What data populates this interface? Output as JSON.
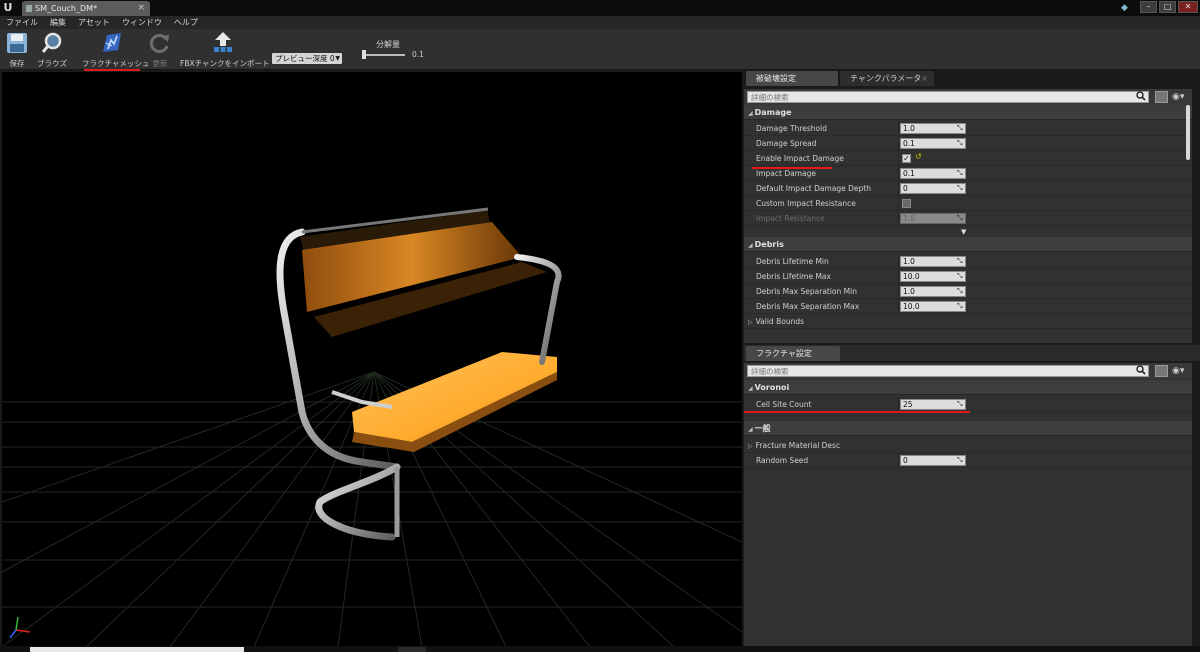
{
  "window": {
    "tab_title": "SM_Couch_DM*",
    "logo_text": "U"
  },
  "menu": [
    "ファイル",
    "編集",
    "アセット",
    "ウィンドウ",
    "ヘルプ"
  ],
  "toolbar": {
    "save": "保存",
    "browse": "ブラウズ",
    "fracture_mesh": "フラクチャメッシュ",
    "refresh": "更新",
    "import_fbx_chunks": "FBXチャンクをインポート",
    "preview_depth": "プレビュー深度 0",
    "resolution_label": "分解量",
    "resolution_value": "0.1"
  },
  "destructible_settings": {
    "tabs": [
      "被破壊設定",
      "チャンクパラメータ"
    ],
    "search_placeholder": "詳細の検索",
    "damage": {
      "title": "Damage",
      "damage_threshold": {
        "label": "Damage Threshold",
        "value": "1.0"
      },
      "damage_spread": {
        "label": "Damage Spread",
        "value": "0.1"
      },
      "enable_impact_damage": {
        "label": "Enable Impact Damage",
        "checked": true
      },
      "impact_damage": {
        "label": "Impact Damage",
        "value": "0.1"
      },
      "default_impact_damage_depth": {
        "label": "Default Impact Damage Depth",
        "value": "0"
      },
      "custom_impact_resistance": {
        "label": "Custom Impact Resistance",
        "checked": false
      },
      "impact_resistance": {
        "label": "Impact Resistance",
        "value": "1.0"
      }
    },
    "debris": {
      "title": "Debris",
      "debris_lifetime_min": {
        "label": "Debris Lifetime Min",
        "value": "1.0"
      },
      "debris_lifetime_max": {
        "label": "Debris Lifetime Max",
        "value": "10.0"
      },
      "debris_max_separation_min": {
        "label": "Debris Max Separation Min",
        "value": "1.0"
      },
      "debris_max_separation_max": {
        "label": "Debris Max Separation Max",
        "value": "10.0"
      },
      "valid_bounds": {
        "label": "Valid Bounds"
      }
    }
  },
  "fracture_settings": {
    "tab": "フラクチャ設定",
    "search_placeholder": "詳細の検索",
    "voronoi": {
      "title": "Voronoi",
      "cell_site_count": {
        "label": "Cell Site Count",
        "value": "25"
      }
    },
    "general": {
      "title": "一般",
      "fracture_material_desc": {
        "label": "Fracture Material Desc"
      },
      "random_seed": {
        "label": "Random Seed",
        "value": "0"
      }
    }
  },
  "colors": {
    "highlight_underline": "#e01a1a",
    "seat_orange": "#ffaa2a",
    "frame_silver": "#cfcfcf"
  }
}
